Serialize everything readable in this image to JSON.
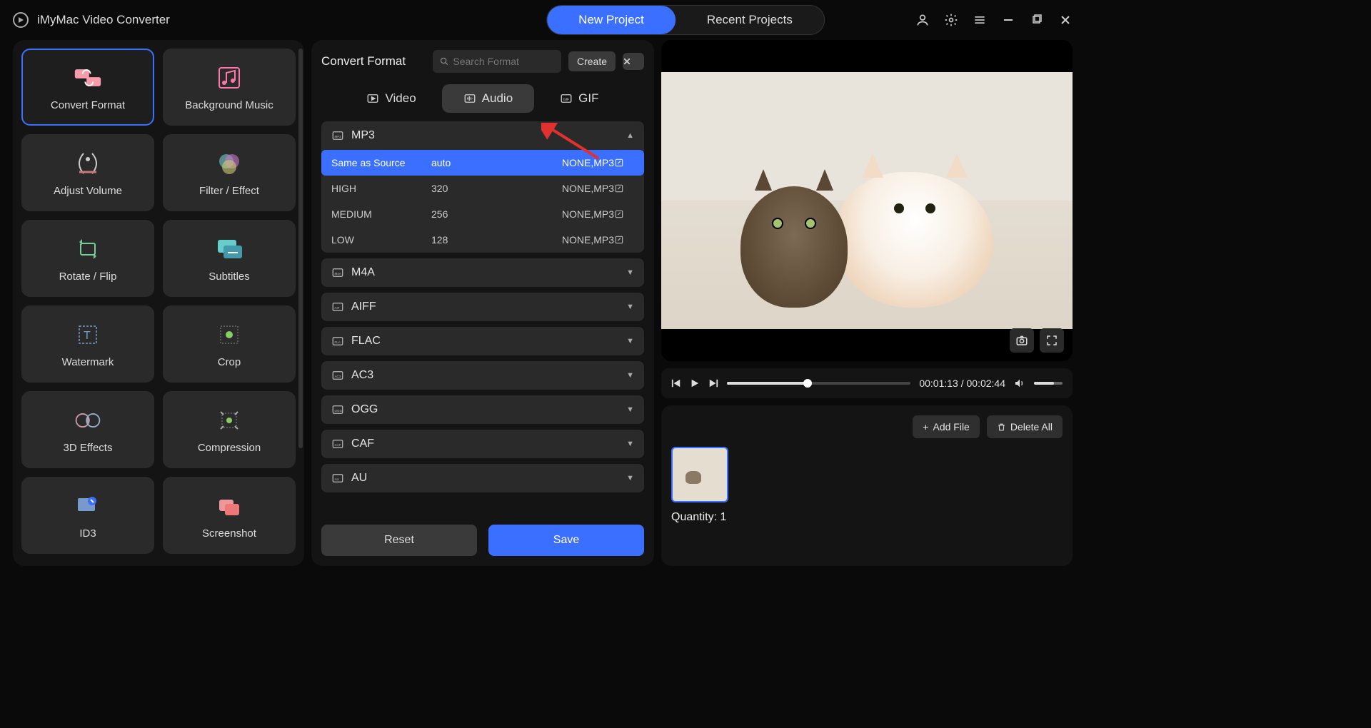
{
  "app": {
    "title": "iMyMac Video Converter"
  },
  "topTabs": {
    "new": "New Project",
    "recent": "Recent Projects"
  },
  "sidebar": {
    "tools": [
      {
        "id": "convert-format",
        "label": "Convert Format",
        "selected": true
      },
      {
        "id": "background-music",
        "label": "Background Music"
      },
      {
        "id": "adjust-volume",
        "label": "Adjust Volume"
      },
      {
        "id": "filter-effect",
        "label": "Filter / Effect"
      },
      {
        "id": "rotate-flip",
        "label": "Rotate / Flip"
      },
      {
        "id": "subtitles",
        "label": "Subtitles"
      },
      {
        "id": "watermark",
        "label": "Watermark"
      },
      {
        "id": "crop",
        "label": "Crop"
      },
      {
        "id": "3d-effects",
        "label": "3D Effects"
      },
      {
        "id": "compression",
        "label": "Compression"
      },
      {
        "id": "id3",
        "label": "ID3"
      },
      {
        "id": "screenshot",
        "label": "Screenshot"
      }
    ]
  },
  "center": {
    "title": "Convert Format",
    "searchPlaceholder": "Search Format",
    "createLabel": "Create",
    "tabs": {
      "video": "Video",
      "audio": "Audio",
      "gif": "GIF"
    },
    "activeTab": "audio",
    "formats": [
      {
        "id": "mp3",
        "label": "MP3",
        "expanded": true,
        "presets": [
          {
            "name": "Same as Source",
            "bitrate": "auto",
            "codec": "NONE,MP3",
            "selected": true
          },
          {
            "name": "HIGH",
            "bitrate": "320",
            "codec": "NONE,MP3"
          },
          {
            "name": "MEDIUM",
            "bitrate": "256",
            "codec": "NONE,MP3"
          },
          {
            "name": "LOW",
            "bitrate": "128",
            "codec": "NONE,MP3"
          }
        ]
      },
      {
        "id": "m4a",
        "label": "M4A"
      },
      {
        "id": "aiff",
        "label": "AIFF"
      },
      {
        "id": "flac",
        "label": "FLAC"
      },
      {
        "id": "ac3",
        "label": "AC3"
      },
      {
        "id": "ogg",
        "label": "OGG"
      },
      {
        "id": "caf",
        "label": "CAF"
      },
      {
        "id": "au",
        "label": "AU"
      }
    ],
    "resetLabel": "Reset",
    "saveLabel": "Save"
  },
  "playback": {
    "current": "00:01:13",
    "total": "00:02:44"
  },
  "filelist": {
    "addLabel": "Add File",
    "deleteLabel": "Delete All",
    "quantityLabel": "Quantity:",
    "quantityValue": "1"
  }
}
